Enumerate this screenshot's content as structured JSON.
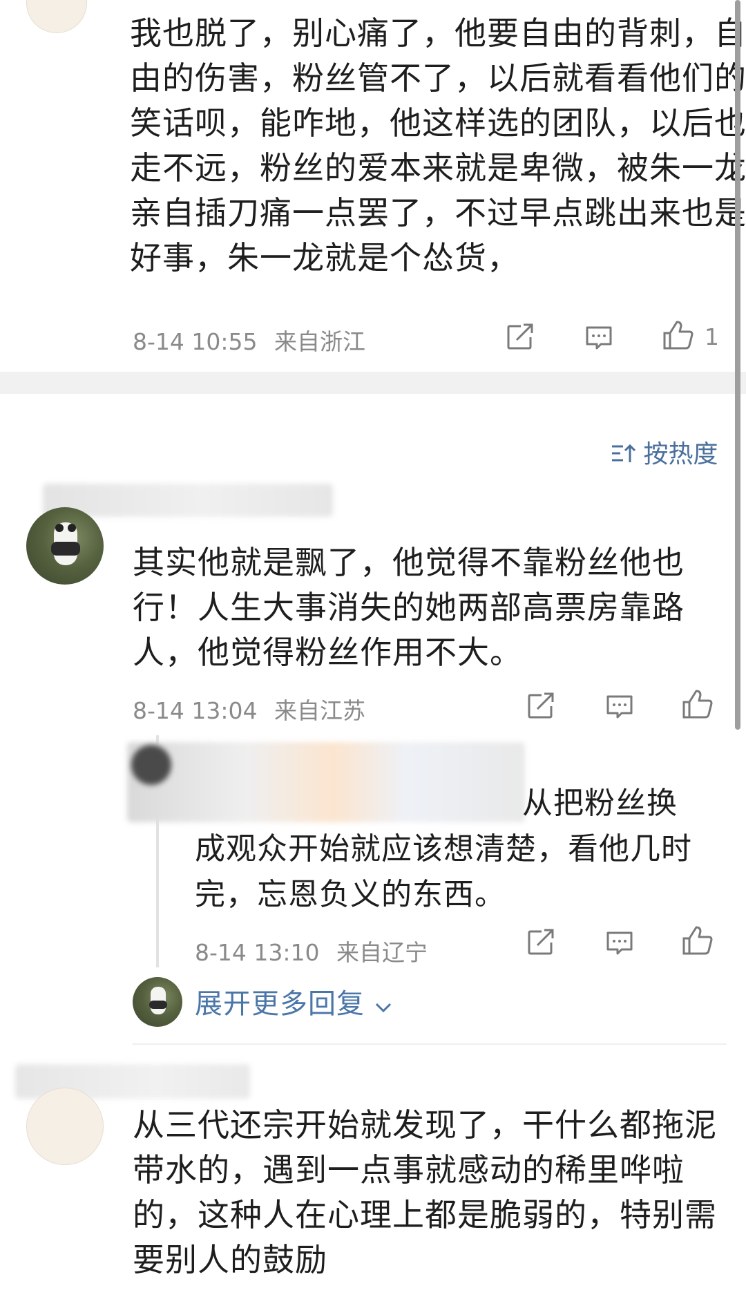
{
  "colors": {
    "link": "#4a76a8",
    "meta": "#8a8a8a",
    "text": "#1e1e1e",
    "band": "#f1f1f1"
  },
  "comment1": {
    "lines": [
      "我也脱了，别心痛了，他要自由的背刺，自",
      "由的伤害，粉丝管不了，以后就看看他们的",
      "笑话呗，能咋地，他这样选的团队，以后也",
      "走不远，粉丝的爱本来就是卑微，被朱一龙",
      "亲自插刀痛一点罢了，不过早点跳出来也是",
      "好事，朱一龙就是个怂货，"
    ],
    "time": "8-14 10:55",
    "location": "来自浙江",
    "like_count": "1"
  },
  "sort": {
    "label": "按热度",
    "icon": "sort-icon"
  },
  "comment2": {
    "lines": [
      "其实他就是飘了，他觉得不靠粉丝他也",
      "行！人生大事消失的她两部高票房靠路",
      "人，他觉得粉丝作用不大。"
    ],
    "time": "8-14 13:04",
    "location": "来自江苏"
  },
  "reply": {
    "lines": [
      "从把粉丝换",
      "成观众开始就应该想清楚，看他几时",
      "完，忘恩负义的东西。"
    ],
    "time": "8-14 13:10",
    "location": "来自辽宁",
    "expand_label": "展开更多回复"
  },
  "comment3": {
    "lines": [
      "从三代还宗开始就发现了，干什么都拖泥",
      "带水的，遇到一点事就感动的稀里哗啦",
      "的，这种人在心理上都是脆弱的，特别需",
      "要别人的鼓励"
    ]
  },
  "icons": [
    "share-icon",
    "comment-icon",
    "like-icon",
    "chevron-down-icon"
  ]
}
